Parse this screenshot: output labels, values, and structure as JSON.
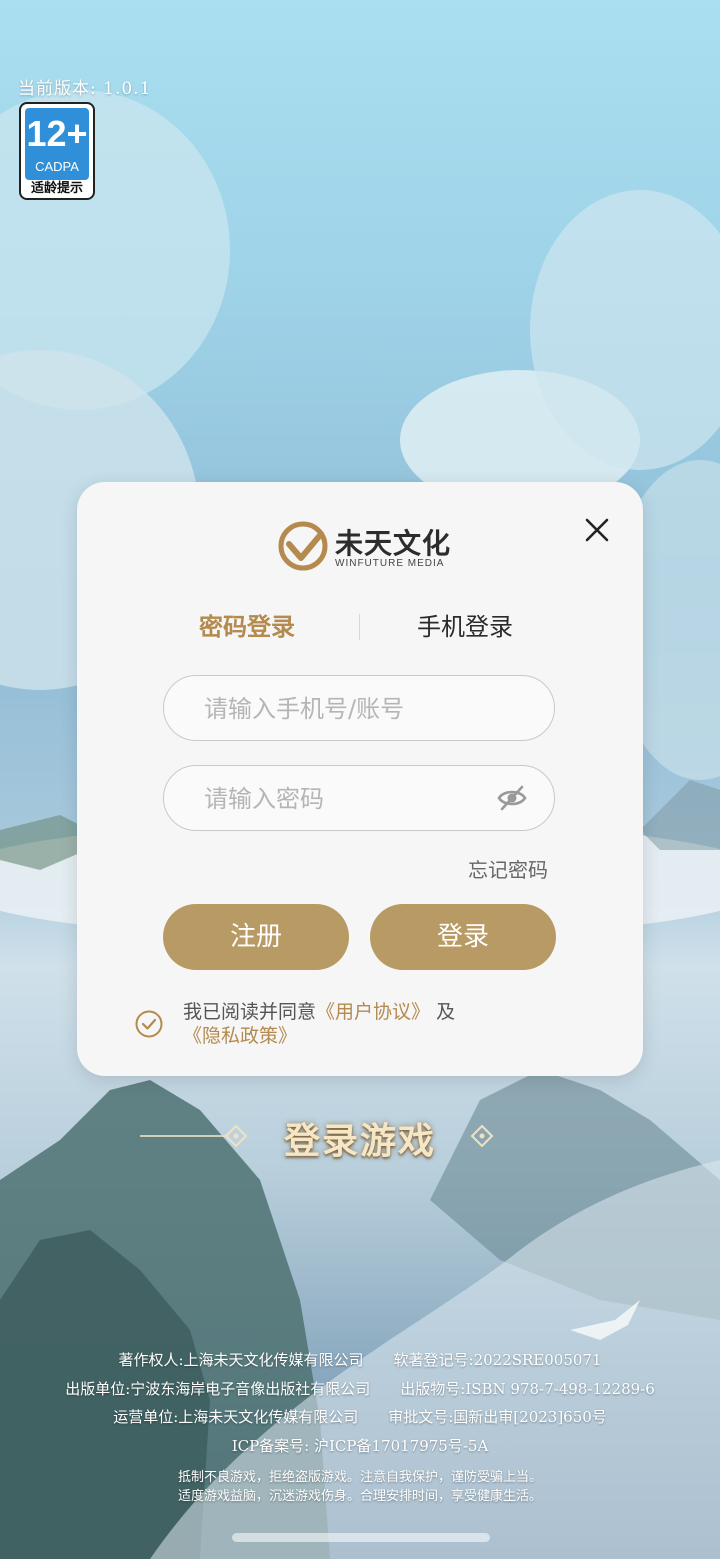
{
  "version_text": "当前版本: 1.0.1",
  "age_rating": {
    "number": "12+",
    "org": "CADPA",
    "label": "适龄提示"
  },
  "brand": {
    "name_cn": "未天文化",
    "name_en": "WINFUTURE MEDIA",
    "color": "#b48a4e"
  },
  "tabs": [
    {
      "label": "密码登录",
      "active": true
    },
    {
      "label": "手机登录",
      "active": false
    }
  ],
  "fields": {
    "account_placeholder": "请输入手机号/账号",
    "password_placeholder": "请输入密码"
  },
  "forgot_label": "忘记密码",
  "buttons": {
    "register": "注册",
    "login": "登录",
    "color": "#b89a64"
  },
  "agreement": {
    "prefix": "我已阅读并同意",
    "user_agreement": "《用户协议》",
    "and": "及",
    "privacy": "《隐私政策》"
  },
  "game_title": "登录游戏",
  "legal": [
    "著作权人:上海未天文化传媒有限公司　　软著登记号:2022SRE005071",
    "出版单位:宁波东海岸电子音像出版社有限公司　　出版物号:ISBN 978-7-498-12289-6",
    "运营单位:上海未天文化传媒有限公司　　审批文号:国新出审[2023]650号",
    "ICP备案号: 沪ICP备17017975号-5A",
    "抵制不良游戏，拒绝盗版游戏。注意自我保护，谨防受骗上当。",
    "适度游戏益脑，沉迷游戏伤身。合理安排时间，享受健康生活。"
  ]
}
